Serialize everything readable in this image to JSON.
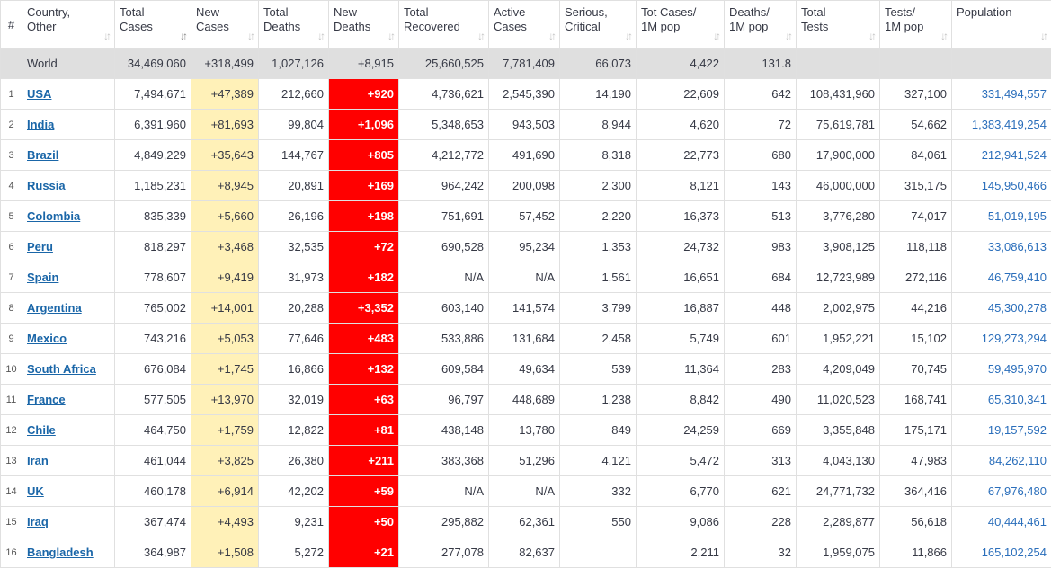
{
  "headers": [
    {
      "l1": "#",
      "l2": ""
    },
    {
      "l1": "Country,",
      "l2": "Other"
    },
    {
      "l1": "Total",
      "l2": "Cases"
    },
    {
      "l1": "New",
      "l2": "Cases"
    },
    {
      "l1": "Total",
      "l2": "Deaths"
    },
    {
      "l1": "New",
      "l2": "Deaths"
    },
    {
      "l1": "Total",
      "l2": "Recovered"
    },
    {
      "l1": "Active",
      "l2": "Cases"
    },
    {
      "l1": "Serious,",
      "l2": "Critical"
    },
    {
      "l1": "Tot Cases/",
      "l2": "1M pop"
    },
    {
      "l1": "Deaths/",
      "l2": "1M pop"
    },
    {
      "l1": "Total",
      "l2": "Tests"
    },
    {
      "l1": "Tests/",
      "l2": "1M pop"
    },
    {
      "l1": "Population",
      "l2": ""
    }
  ],
  "world": {
    "country": "World",
    "total_cases": "34,469,060",
    "new_cases": "+318,499",
    "total_deaths": "1,027,126",
    "new_deaths": "+8,915",
    "total_recovered": "25,660,525",
    "active_cases": "7,781,409",
    "serious_critical": "66,073",
    "tot_cases_per_1m": "4,422",
    "deaths_per_1m": "131.8",
    "total_tests": "",
    "tests_per_1m": "",
    "population": ""
  },
  "rows": [
    {
      "rank": "1",
      "country": "USA",
      "total_cases": "7,494,671",
      "new_cases": "+47,389",
      "total_deaths": "212,660",
      "new_deaths": "+920",
      "total_recovered": "4,736,621",
      "active_cases": "2,545,390",
      "serious_critical": "14,190",
      "tot_cases_per_1m": "22,609",
      "deaths_per_1m": "642",
      "total_tests": "108,431,960",
      "tests_per_1m": "327,100",
      "population": "331,494,557"
    },
    {
      "rank": "2",
      "country": "India",
      "total_cases": "6,391,960",
      "new_cases": "+81,693",
      "total_deaths": "99,804",
      "new_deaths": "+1,096",
      "total_recovered": "5,348,653",
      "active_cases": "943,503",
      "serious_critical": "8,944",
      "tot_cases_per_1m": "4,620",
      "deaths_per_1m": "72",
      "total_tests": "75,619,781",
      "tests_per_1m": "54,662",
      "population": "1,383,419,254"
    },
    {
      "rank": "3",
      "country": "Brazil",
      "total_cases": "4,849,229",
      "new_cases": "+35,643",
      "total_deaths": "144,767",
      "new_deaths": "+805",
      "total_recovered": "4,212,772",
      "active_cases": "491,690",
      "serious_critical": "8,318",
      "tot_cases_per_1m": "22,773",
      "deaths_per_1m": "680",
      "total_tests": "17,900,000",
      "tests_per_1m": "84,061",
      "population": "212,941,524"
    },
    {
      "rank": "4",
      "country": "Russia",
      "total_cases": "1,185,231",
      "new_cases": "+8,945",
      "total_deaths": "20,891",
      "new_deaths": "+169",
      "total_recovered": "964,242",
      "active_cases": "200,098",
      "serious_critical": "2,300",
      "tot_cases_per_1m": "8,121",
      "deaths_per_1m": "143",
      "total_tests": "46,000,000",
      "tests_per_1m": "315,175",
      "population": "145,950,466"
    },
    {
      "rank": "5",
      "country": "Colombia",
      "total_cases": "835,339",
      "new_cases": "+5,660",
      "total_deaths": "26,196",
      "new_deaths": "+198",
      "total_recovered": "751,691",
      "active_cases": "57,452",
      "serious_critical": "2,220",
      "tot_cases_per_1m": "16,373",
      "deaths_per_1m": "513",
      "total_tests": "3,776,280",
      "tests_per_1m": "74,017",
      "population": "51,019,195"
    },
    {
      "rank": "6",
      "country": "Peru",
      "total_cases": "818,297",
      "new_cases": "+3,468",
      "total_deaths": "32,535",
      "new_deaths": "+72",
      "total_recovered": "690,528",
      "active_cases": "95,234",
      "serious_critical": "1,353",
      "tot_cases_per_1m": "24,732",
      "deaths_per_1m": "983",
      "total_tests": "3,908,125",
      "tests_per_1m": "118,118",
      "population": "33,086,613"
    },
    {
      "rank": "7",
      "country": "Spain",
      "total_cases": "778,607",
      "new_cases": "+9,419",
      "total_deaths": "31,973",
      "new_deaths": "+182",
      "total_recovered": "N/A",
      "active_cases": "N/A",
      "serious_critical": "1,561",
      "tot_cases_per_1m": "16,651",
      "deaths_per_1m": "684",
      "total_tests": "12,723,989",
      "tests_per_1m": "272,116",
      "population": "46,759,410"
    },
    {
      "rank": "8",
      "country": "Argentina",
      "total_cases": "765,002",
      "new_cases": "+14,001",
      "total_deaths": "20,288",
      "new_deaths": "+3,352",
      "total_recovered": "603,140",
      "active_cases": "141,574",
      "serious_critical": "3,799",
      "tot_cases_per_1m": "16,887",
      "deaths_per_1m": "448",
      "total_tests": "2,002,975",
      "tests_per_1m": "44,216",
      "population": "45,300,278"
    },
    {
      "rank": "9",
      "country": "Mexico",
      "total_cases": "743,216",
      "new_cases": "+5,053",
      "total_deaths": "77,646",
      "new_deaths": "+483",
      "total_recovered": "533,886",
      "active_cases": "131,684",
      "serious_critical": "2,458",
      "tot_cases_per_1m": "5,749",
      "deaths_per_1m": "601",
      "total_tests": "1,952,221",
      "tests_per_1m": "15,102",
      "population": "129,273,294"
    },
    {
      "rank": "10",
      "country": "South Africa",
      "total_cases": "676,084",
      "new_cases": "+1,745",
      "total_deaths": "16,866",
      "new_deaths": "+132",
      "total_recovered": "609,584",
      "active_cases": "49,634",
      "serious_critical": "539",
      "tot_cases_per_1m": "11,364",
      "deaths_per_1m": "283",
      "total_tests": "4,209,049",
      "tests_per_1m": "70,745",
      "population": "59,495,970"
    },
    {
      "rank": "11",
      "country": "France",
      "total_cases": "577,505",
      "new_cases": "+13,970",
      "total_deaths": "32,019",
      "new_deaths": "+63",
      "total_recovered": "96,797",
      "active_cases": "448,689",
      "serious_critical": "1,238",
      "tot_cases_per_1m": "8,842",
      "deaths_per_1m": "490",
      "total_tests": "11,020,523",
      "tests_per_1m": "168,741",
      "population": "65,310,341"
    },
    {
      "rank": "12",
      "country": "Chile",
      "total_cases": "464,750",
      "new_cases": "+1,759",
      "total_deaths": "12,822",
      "new_deaths": "+81",
      "total_recovered": "438,148",
      "active_cases": "13,780",
      "serious_critical": "849",
      "tot_cases_per_1m": "24,259",
      "deaths_per_1m": "669",
      "total_tests": "3,355,848",
      "tests_per_1m": "175,171",
      "population": "19,157,592"
    },
    {
      "rank": "13",
      "country": "Iran",
      "total_cases": "461,044",
      "new_cases": "+3,825",
      "total_deaths": "26,380",
      "new_deaths": "+211",
      "total_recovered": "383,368",
      "active_cases": "51,296",
      "serious_critical": "4,121",
      "tot_cases_per_1m": "5,472",
      "deaths_per_1m": "313",
      "total_tests": "4,043,130",
      "tests_per_1m": "47,983",
      "population": "84,262,110"
    },
    {
      "rank": "14",
      "country": "UK",
      "total_cases": "460,178",
      "new_cases": "+6,914",
      "total_deaths": "42,202",
      "new_deaths": "+59",
      "total_recovered": "N/A",
      "active_cases": "N/A",
      "serious_critical": "332",
      "tot_cases_per_1m": "6,770",
      "deaths_per_1m": "621",
      "total_tests": "24,771,732",
      "tests_per_1m": "364,416",
      "population": "67,976,480"
    },
    {
      "rank": "15",
      "country": "Iraq",
      "total_cases": "367,474",
      "new_cases": "+4,493",
      "total_deaths": "9,231",
      "new_deaths": "+50",
      "total_recovered": "295,882",
      "active_cases": "62,361",
      "serious_critical": "550",
      "tot_cases_per_1m": "9,086",
      "deaths_per_1m": "228",
      "total_tests": "2,289,877",
      "tests_per_1m": "56,618",
      "population": "40,444,461"
    },
    {
      "rank": "16",
      "country": "Bangladesh",
      "total_cases": "364,987",
      "new_cases": "+1,508",
      "total_deaths": "5,272",
      "new_deaths": "+21",
      "total_recovered": "277,078",
      "active_cases": "82,637",
      "serious_critical": "",
      "tot_cases_per_1m": "2,211",
      "deaths_per_1m": "32",
      "total_tests": "1,959,075",
      "tests_per_1m": "11,866",
      "population": "165,102,254"
    }
  ],
  "colors": {
    "new_cases_bg": "#fff1b8",
    "new_deaths_bg": "#ff0000",
    "link": "#1a66a8",
    "world_bg": "#dfdfdf"
  }
}
